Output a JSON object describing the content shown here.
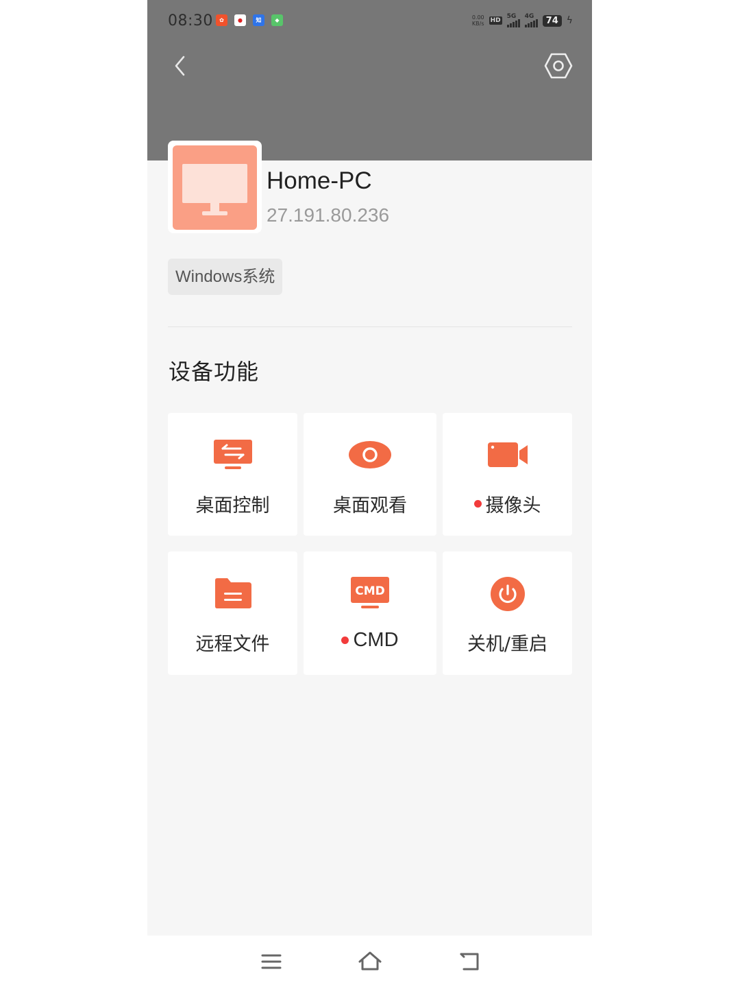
{
  "status_bar": {
    "time": "08:30",
    "net_speed_value": "0.00",
    "net_speed_unit": "KB/s",
    "hd_label": "HD",
    "net_5g_label": "5G",
    "net_4g_label": "4G",
    "battery": "74",
    "notification_icons": [
      "app-icon-orange",
      "app-icon-red",
      "app-icon-blue",
      "app-icon-green"
    ]
  },
  "header": {
    "background": "#777777",
    "back_icon": "chevron-left-icon",
    "settings_icon": "hex-settings-icon"
  },
  "device": {
    "name": "Home-PC",
    "ip": "27.191.80.236",
    "os_badge": "Windows系统",
    "icon": "monitor-icon",
    "icon_color": "#fa9f85"
  },
  "section": {
    "title": "设备功能"
  },
  "accent_color": "#f26b45",
  "features": [
    {
      "label": "桌面控制",
      "icon": "desktop-transfer-icon",
      "dot": false
    },
    {
      "label": "桌面观看",
      "icon": "eye-icon",
      "dot": false
    },
    {
      "label": "摄像头",
      "icon": "video-camera-icon",
      "dot": true
    },
    {
      "label": "远程文件",
      "icon": "folder-icon",
      "dot": false
    },
    {
      "label": "CMD",
      "icon": "cmd-icon",
      "dot": true,
      "icon_text": "CMD"
    },
    {
      "label": "关机/重启",
      "icon": "power-icon",
      "dot": false
    }
  ],
  "navbar": {
    "menu_icon": "menu-icon",
    "home_icon": "home-icon",
    "back_icon": "back-icon"
  }
}
